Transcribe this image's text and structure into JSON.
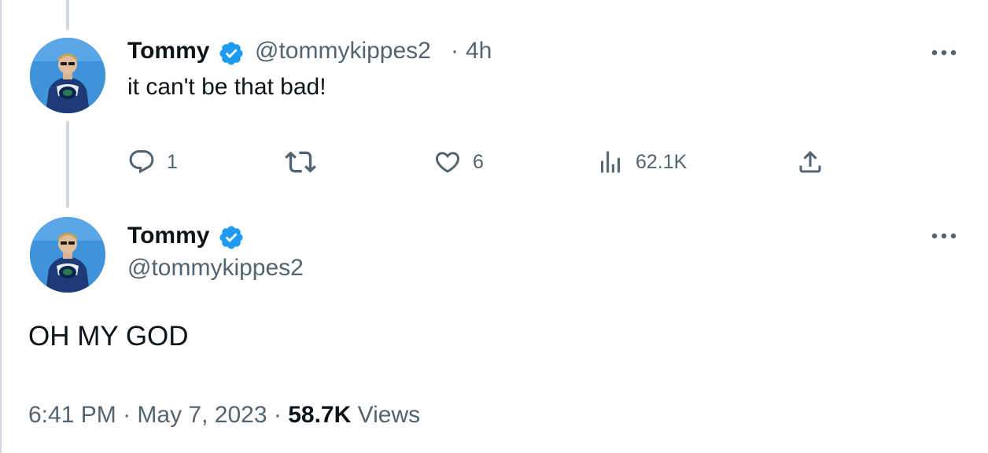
{
  "reply_tweet": {
    "author_name": "Tommy",
    "author_handle": "@tommykippes2",
    "separator": "·",
    "time_ago": "4h",
    "text": "it can't be that bad!",
    "actions": {
      "reply_count": "1",
      "like_count": "6",
      "view_count": "62.1K"
    }
  },
  "main_tweet": {
    "author_name": "Tommy",
    "author_handle": "@tommykippes2",
    "text": "OH MY GOD",
    "time": "6:41 PM",
    "separator": "·",
    "date": "May 7, 2023",
    "separator2": "·",
    "views_count": "58.7K",
    "views_label": "Views"
  },
  "icons": {
    "verified": "verified-badge-icon",
    "more": "more-options-icon",
    "reply": "reply-icon",
    "retweet": "retweet-icon",
    "like": "heart-icon",
    "views": "analytics-icon",
    "share": "share-icon"
  },
  "colors": {
    "verified_blue": "#1d9bf0",
    "text_primary": "#0f1419",
    "text_secondary": "#536471",
    "thread_line": "#cfd9de"
  }
}
